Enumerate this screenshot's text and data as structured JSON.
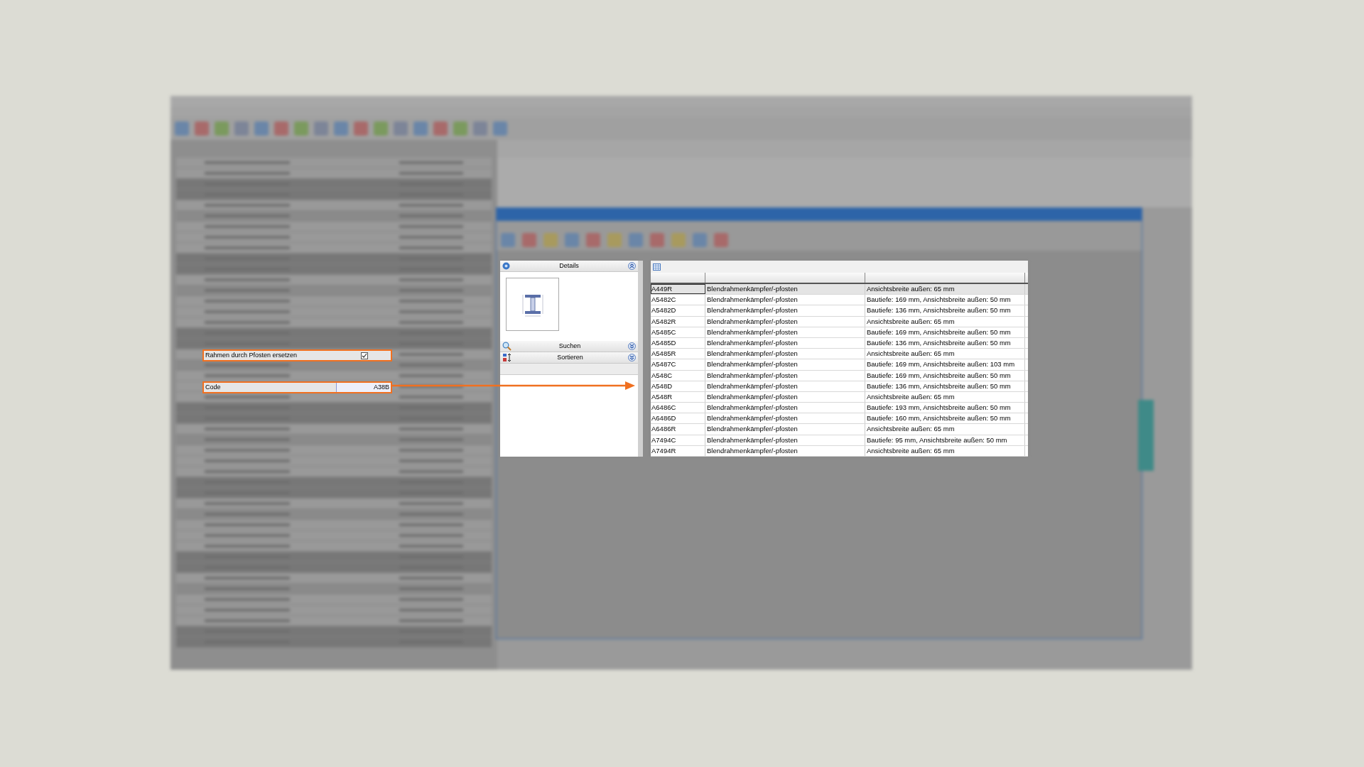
{
  "property_rows": [
    {
      "kind": "checkbox",
      "label": "Rahmen durch Pfosten ersetzen",
      "checked": true
    },
    {
      "kind": "text",
      "label": "Code",
      "value": "A38B"
    }
  ],
  "side_panel": {
    "sections": [
      {
        "kind": "info",
        "title": "Details",
        "expanded": true
      },
      {
        "kind": "search",
        "title": "Suchen",
        "expanded": false
      },
      {
        "kind": "sort",
        "title": "Sortieren",
        "expanded": false
      }
    ]
  },
  "table": {
    "rows": [
      {
        "code": "A449R",
        "name": "Blendrahmenkämpfer/-pfosten",
        "description": "Ansichtsbreite außen: 65 mm",
        "selected": true
      },
      {
        "code": "A5482C",
        "name": "Blendrahmenkämpfer/-pfosten",
        "description": "Bautiefe: 169 mm, Ansichtsbreite außen: 50 mm",
        "selected": false
      },
      {
        "code": "A5482D",
        "name": "Blendrahmenkämpfer/-pfosten",
        "description": "Bautiefe: 136 mm, Ansichtsbreite außen: 50 mm",
        "selected": false
      },
      {
        "code": "A5482R",
        "name": "Blendrahmenkämpfer/-pfosten",
        "description": "Ansichtsbreite außen: 65 mm",
        "selected": false
      },
      {
        "code": "A5485C",
        "name": "Blendrahmenkämpfer/-pfosten",
        "description": "Bautiefe: 169 mm, Ansichtsbreite außen: 50 mm",
        "selected": false
      },
      {
        "code": "A5485D",
        "name": "Blendrahmenkämpfer/-pfosten",
        "description": "Bautiefe: 136 mm, Ansichtsbreite außen: 50 mm",
        "selected": false
      },
      {
        "code": "A5485R",
        "name": "Blendrahmenkämpfer/-pfosten",
        "description": "Ansichtsbreite außen: 65 mm",
        "selected": false
      },
      {
        "code": "A5487C",
        "name": "Blendrahmenkämpfer/-pfosten",
        "description": "Bautiefe: 169 mm, Ansichtsbreite außen: 103 mm",
        "selected": false
      },
      {
        "code": "A548C",
        "name": "Blendrahmenkämpfer/-pfosten",
        "description": "Bautiefe: 169 mm, Ansichtsbreite außen: 50 mm",
        "selected": false
      },
      {
        "code": "A548D",
        "name": "Blendrahmenkämpfer/-pfosten",
        "description": "Bautiefe: 136 mm, Ansichtsbreite außen: 50 mm",
        "selected": false
      },
      {
        "code": "A548R",
        "name": "Blendrahmenkämpfer/-pfosten",
        "description": "Ansichtsbreite außen: 65 mm",
        "selected": false
      },
      {
        "code": "A6486C",
        "name": "Blendrahmenkämpfer/-pfosten",
        "description": "Bautiefe: 193 mm, Ansichtsbreite außen: 50 mm",
        "selected": false
      },
      {
        "code": "A6486D",
        "name": "Blendrahmenkämpfer/-pfosten",
        "description": "Bautiefe: 160 mm, Ansichtsbreite außen: 50 mm",
        "selected": false
      },
      {
        "code": "A6486R",
        "name": "Blendrahmenkämpfer/-pfosten",
        "description": "Ansichtsbreite außen: 65 mm",
        "selected": false
      },
      {
        "code": "A7494C",
        "name": "Blendrahmenkämpfer/-pfosten",
        "description": "Bautiefe: 95 mm, Ansichtsbreite außen: 50 mm",
        "selected": false
      },
      {
        "code": "A7494R",
        "name": "Blendrahmenkämpfer/-pfosten",
        "description": "Ansichtsbreite außen: 65 mm",
        "selected": false
      }
    ]
  }
}
